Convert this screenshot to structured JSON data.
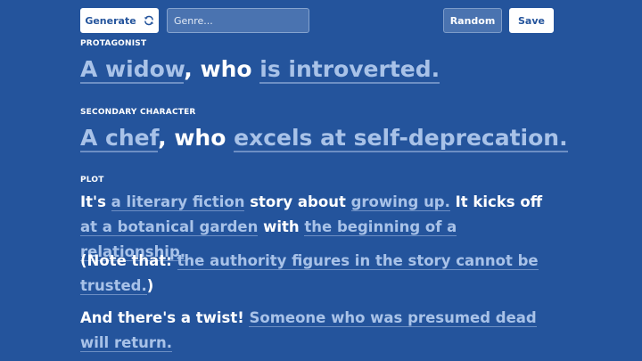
{
  "toolbar": {
    "generate_label": "Generate",
    "genre_placeholder": "Genre...",
    "genre_value": "",
    "random_label": "Random",
    "save_label": "Save"
  },
  "protagonist": {
    "label": "PROTAGONIST",
    "who": "A widow",
    "joiner": ", who ",
    "trait": "is introverted."
  },
  "secondary": {
    "label": "SECONDARY CHARACTER",
    "who": "A chef",
    "joiner": ", who ",
    "trait": "excels at self-deprecation."
  },
  "plot": {
    "label": "PLOT",
    "p1": {
      "t1": "It's ",
      "genre": "a literary fiction",
      "t2": " story about ",
      "theme": "growing up.",
      "t3": " It kicks off ",
      "setting": "at a botanical garden",
      "t4": " with ",
      "inciting": "the beginning of a relationship."
    },
    "p2": {
      "t1": "(Note that: ",
      "note": "the authority figures in the story cannot be trusted.",
      "t2": ")"
    },
    "p3": {
      "t1": "And there's a twist! ",
      "twist": "Someone who was presumed dead will return."
    }
  },
  "colors": {
    "background": "#24549c",
    "highlight_text": "#a8c2e8",
    "underline": "#6d8fc4"
  },
  "icons": {
    "generate": "refresh-icon"
  }
}
